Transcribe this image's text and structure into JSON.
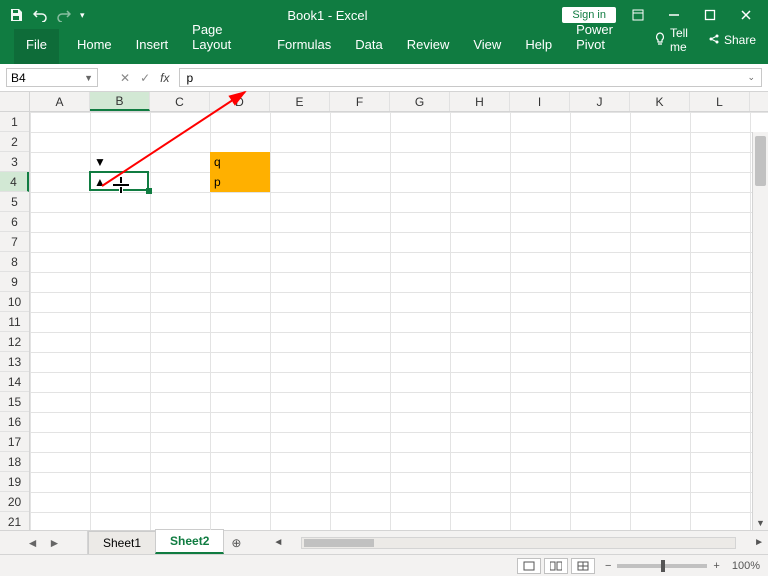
{
  "app": {
    "title": "Book1 - Excel",
    "signin": "Sign in"
  },
  "ribbon": {
    "file": "File",
    "tabs": [
      "Home",
      "Insert",
      "Page Layout",
      "Formulas",
      "Data",
      "Review",
      "View",
      "Help",
      "Power Pivot"
    ],
    "tellme": "Tell me",
    "share": "Share"
  },
  "fx": {
    "namebox": "B4",
    "formula": "p",
    "fx_label": "fx"
  },
  "columns": [
    "A",
    "B",
    "C",
    "D",
    "E",
    "F",
    "G",
    "H",
    "I",
    "J",
    "K",
    "L"
  ],
  "sel_col_index": 1,
  "rows": 21,
  "sel_row_index": 3,
  "cells": {
    "B3": "▼",
    "B4": "▲",
    "D3": "q",
    "D4": "p"
  },
  "orange_cells": [
    "D3",
    "D4"
  ],
  "selected_cell": "B4",
  "sheets": {
    "tabs": [
      "Sheet1",
      "Sheet2"
    ],
    "active": 1
  },
  "status": {
    "zoom": "100%",
    "zoom_minus": "−",
    "zoom_plus": "+"
  }
}
